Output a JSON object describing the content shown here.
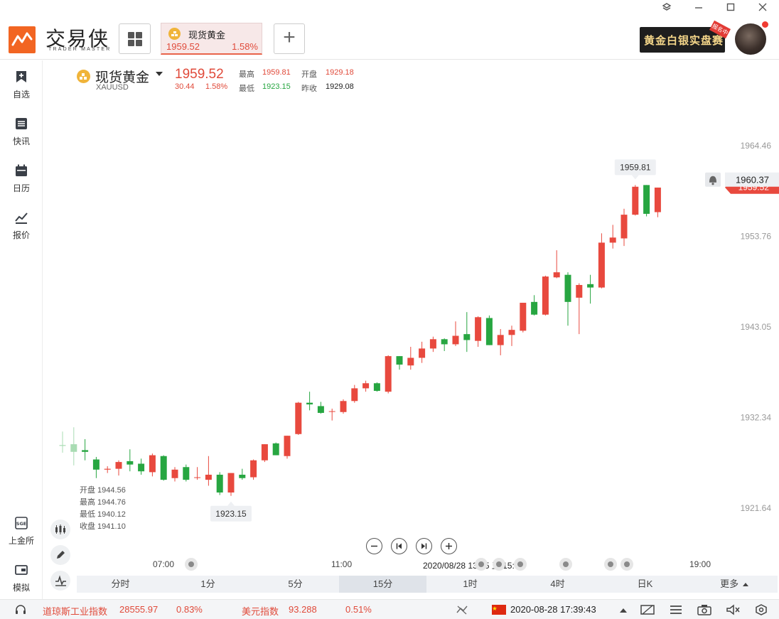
{
  "app": {
    "logo_text": "交易侠",
    "logo_sub": "TRADER MASTER",
    "brand_color": "#f26522"
  },
  "window_controls": [
    "layers-icon",
    "minimize-icon",
    "maximize-icon",
    "close-icon"
  ],
  "tab": {
    "name": "现货黄金",
    "price": "1959.52",
    "change_pct": "1.58%"
  },
  "banner": {
    "text": "黄金白银实盘赛",
    "tag": "报名中"
  },
  "sidebar": {
    "items": [
      {
        "label": "自选",
        "icon": "bookmark-plus-icon"
      },
      {
        "label": "快讯",
        "icon": "news-list-icon"
      },
      {
        "label": "日历",
        "icon": "calendar-icon"
      },
      {
        "label": "报价",
        "icon": "trend-line-icon"
      }
    ],
    "bottom_items": [
      {
        "label": "上金所",
        "icon": "sge-icon"
      },
      {
        "label": "模拟",
        "icon": "wallet-icon"
      }
    ]
  },
  "quote": {
    "name": "现货黄金",
    "symbol": "XAUUSD",
    "price": "1959.52",
    "change": "30.44",
    "change_pct": "1.58%",
    "high_label": "最高",
    "high": "1959.81",
    "open_label": "开盘",
    "open": "1929.18",
    "low_label": "最低",
    "low": "1923.15",
    "prev_close_label": "昨收",
    "prev_close": "1929.08"
  },
  "ohlc_panel": {
    "open": "开盘 1944.56",
    "high": "最高 1944.76",
    "low": "最低 1940.12",
    "close": "收盘 1941.10"
  },
  "colors": {
    "up": "#e8493e",
    "down": "#27a641",
    "accent": "#e8634a"
  },
  "chart_data": {
    "type": "candlestick",
    "y_axis_ticks": [
      "1964.46",
      "1953.76",
      "1943.05",
      "1932.34",
      "1921.64"
    ],
    "ylim": [
      1916.2,
      1969.9
    ],
    "x_ticks": [
      "07:00",
      "11:00",
      "19:00"
    ],
    "crosshair_time": "2020/08/28 13:45 五 15:00",
    "current_price": "1959.52",
    "hover_price": "1960.37",
    "max_label": "1959.81",
    "min_label": "1923.15",
    "candles": [
      {
        "o": 1929.1,
        "h": 1930.7,
        "l": 1928.2,
        "c": 1929.0,
        "faded": true
      },
      {
        "o": 1929.2,
        "h": 1931.2,
        "l": 1926.7,
        "c": 1928.3,
        "faded": true
      },
      {
        "o": 1928.5,
        "h": 1929.8,
        "l": 1927.3,
        "c": 1928.3
      },
      {
        "o": 1927.4,
        "h": 1927.7,
        "l": 1925.2,
        "c": 1926.2
      },
      {
        "o": 1926.2,
        "h": 1926.6,
        "l": 1925.8,
        "c": 1926.3
      },
      {
        "o": 1926.3,
        "h": 1927.3,
        "l": 1925.5,
        "c": 1927.1
      },
      {
        "o": 1927.2,
        "h": 1928.6,
        "l": 1926.0,
        "c": 1926.8
      },
      {
        "o": 1926.9,
        "h": 1927.5,
        "l": 1925.6,
        "c": 1926.0
      },
      {
        "o": 1925.9,
        "h": 1928.1,
        "l": 1925.4,
        "c": 1927.9
      },
      {
        "o": 1927.8,
        "h": 1927.9,
        "l": 1924.9,
        "c": 1925.0
      },
      {
        "o": 1925.2,
        "h": 1926.5,
        "l": 1924.8,
        "c": 1926.2
      },
      {
        "o": 1926.5,
        "h": 1926.8,
        "l": 1924.8,
        "c": 1925.0
      },
      {
        "o": 1925.3,
        "h": 1926.5,
        "l": 1925.0,
        "c": 1925.3
      },
      {
        "o": 1925.0,
        "h": 1927.8,
        "l": 1924.3,
        "c": 1925.6
      },
      {
        "o": 1925.6,
        "h": 1925.9,
        "l": 1923.2,
        "c": 1923.5
      },
      {
        "o": 1923.5,
        "h": 1925.8,
        "l": 1923.1,
        "c": 1925.8
      },
      {
        "o": 1925.6,
        "h": 1926.3,
        "l": 1925.0,
        "c": 1925.2
      },
      {
        "o": 1925.3,
        "h": 1927.4,
        "l": 1925.0,
        "c": 1927.3
      },
      {
        "o": 1927.3,
        "h": 1929.2,
        "l": 1927.1,
        "c": 1929.2
      },
      {
        "o": 1929.3,
        "h": 1929.4,
        "l": 1927.9,
        "c": 1927.9
      },
      {
        "o": 1927.8,
        "h": 1930.2,
        "l": 1927.5,
        "c": 1930.2
      },
      {
        "o": 1930.4,
        "h": 1934.2,
        "l": 1930.3,
        "c": 1934.1
      },
      {
        "o": 1934.1,
        "h": 1935.4,
        "l": 1933.2,
        "c": 1933.9
      },
      {
        "o": 1933.7,
        "h": 1934.2,
        "l": 1932.8,
        "c": 1932.9
      },
      {
        "o": 1933.1,
        "h": 1933.4,
        "l": 1932.0,
        "c": 1933.1
      },
      {
        "o": 1933.0,
        "h": 1934.5,
        "l": 1932.8,
        "c": 1934.3
      },
      {
        "o": 1934.3,
        "h": 1936.2,
        "l": 1934.1,
        "c": 1935.8
      },
      {
        "o": 1935.8,
        "h": 1936.7,
        "l": 1935.4,
        "c": 1936.4
      },
      {
        "o": 1936.4,
        "h": 1936.5,
        "l": 1935.4,
        "c": 1935.5
      },
      {
        "o": 1935.4,
        "h": 1939.7,
        "l": 1935.2,
        "c": 1939.6
      },
      {
        "o": 1939.6,
        "h": 1939.6,
        "l": 1938.0,
        "c": 1938.6
      },
      {
        "o": 1938.5,
        "h": 1940.7,
        "l": 1938.0,
        "c": 1939.4
      },
      {
        "o": 1939.4,
        "h": 1941.3,
        "l": 1938.8,
        "c": 1940.5
      },
      {
        "o": 1940.5,
        "h": 1941.9,
        "l": 1940.1,
        "c": 1941.6
      },
      {
        "o": 1941.6,
        "h": 1941.7,
        "l": 1940.2,
        "c": 1941.0
      },
      {
        "o": 1941.0,
        "h": 1943.7,
        "l": 1940.8,
        "c": 1942.0
      },
      {
        "o": 1942.2,
        "h": 1944.8,
        "l": 1940.1,
        "c": 1941.5
      },
      {
        "o": 1941.4,
        "h": 1944.3,
        "l": 1940.7,
        "c": 1944.2
      },
      {
        "o": 1944.1,
        "h": 1944.4,
        "l": 1940.9,
        "c": 1940.9
      },
      {
        "o": 1940.9,
        "h": 1942.8,
        "l": 1939.7,
        "c": 1942.1
      },
      {
        "o": 1942.1,
        "h": 1943.2,
        "l": 1940.8,
        "c": 1942.7
      },
      {
        "o": 1942.6,
        "h": 1945.9,
        "l": 1942.4,
        "c": 1945.9
      },
      {
        "o": 1946.0,
        "h": 1946.8,
        "l": 1944.4,
        "c": 1944.5
      },
      {
        "o": 1944.5,
        "h": 1949.1,
        "l": 1944.4,
        "c": 1949.0
      },
      {
        "o": 1948.9,
        "h": 1952.1,
        "l": 1948.8,
        "c": 1949.5
      },
      {
        "o": 1949.2,
        "h": 1949.5,
        "l": 1943.2,
        "c": 1946.0
      },
      {
        "o": 1946.5,
        "h": 1948.2,
        "l": 1942.2,
        "c": 1948.0
      },
      {
        "o": 1948.1,
        "h": 1949.2,
        "l": 1945.8,
        "c": 1947.7
      },
      {
        "o": 1947.7,
        "h": 1954.1,
        "l": 1947.6,
        "c": 1953.0
      },
      {
        "o": 1953.0,
        "h": 1955.1,
        "l": 1952.3,
        "c": 1953.6
      },
      {
        "o": 1953.5,
        "h": 1957.0,
        "l": 1952.6,
        "c": 1956.3
      },
      {
        "o": 1956.3,
        "h": 1959.8,
        "l": 1956.2,
        "c": 1959.6
      },
      {
        "o": 1959.8,
        "h": 1959.8,
        "l": 1956.1,
        "c": 1956.4
      },
      {
        "o": 1956.6,
        "h": 1959.5,
        "l": 1956.0,
        "c": 1959.5
      }
    ]
  },
  "time_axis": {
    "t1": "07:00",
    "t2": "11:00",
    "t3": "19:00",
    "crosshair": "2020/08/28 13:45 五 15:00"
  },
  "periods": [
    "分时",
    "1分",
    "5分",
    "15分",
    "1时",
    "4时",
    "日K",
    "更多"
  ],
  "active_period": "15分",
  "ticker": {
    "dow_name": "道琼斯工业指数",
    "dow_value": "28555.97",
    "dow_pct": "0.83%",
    "usd_name": "美元指数",
    "usd_value": "93.288",
    "usd_pct": "0.51%",
    "datetime": "2020-08-28 17:39:43"
  }
}
